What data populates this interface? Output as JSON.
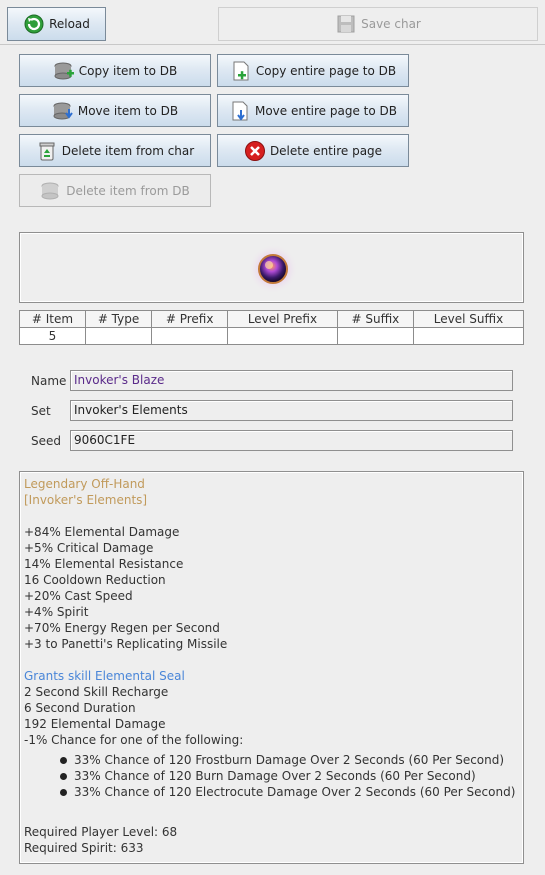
{
  "toolbar": {
    "reload_prefix": "",
    "reload_label": "Reload",
    "save_label": "Save char"
  },
  "actions": {
    "copy_item": "Copy item to DB",
    "copy_page": "Copy entire page to DB",
    "move_item": "Move item to DB",
    "move_page": "Move entire page to DB",
    "delete_item_char": "Delete item from char",
    "delete_page": "Delete entire page",
    "delete_item_db": "Delete item from DB"
  },
  "table": {
    "headers": [
      "# Item",
      "# Type",
      "# Prefix",
      "Level Prefix",
      "# Suffix",
      "Level Suffix"
    ],
    "row": [
      "5",
      "",
      "",
      "",
      "",
      ""
    ]
  },
  "fields": {
    "name_label": "Name",
    "name_value": "Invoker's Blaze",
    "set_label": "Set",
    "set_value": "Invoker's Elements",
    "seed_label": "Seed",
    "seed_value": "9060C1FE"
  },
  "description": {
    "rarity": "Legendary Off-Hand",
    "set": "[Invoker's Elements]",
    "stats": [
      "+84% Elemental Damage",
      "+5% Critical Damage",
      "14% Elemental Resistance",
      "16 Cooldown Reduction",
      "+20% Cast Speed",
      "+4% Spirit",
      "+70% Energy Regen per Second",
      "+3 to Panetti's Replicating Missile"
    ],
    "skill_title": "Grants skill Elemental Seal",
    "skill_stats": [
      "2 Second Skill Recharge",
      "6 Second Duration",
      "192 Elemental Damage",
      "-1% Chance for one of the following:"
    ],
    "chances": [
      "33% Chance of 120 Frostburn Damage Over 2 Seconds (60 Per Second)",
      "33% Chance of 120 Burn Damage Over 2 Seconds (60 Per Second)",
      "33% Chance of 120 Electrocute Damage Over 2 Seconds (60 Per Second)"
    ],
    "req_level": "Required Player Level: 68",
    "req_spirit": "Required Spirit: 633"
  },
  "colors": {
    "legendary": "#c19a5b",
    "skill": "#4a86d8",
    "name_value": "#5a2a8a"
  }
}
